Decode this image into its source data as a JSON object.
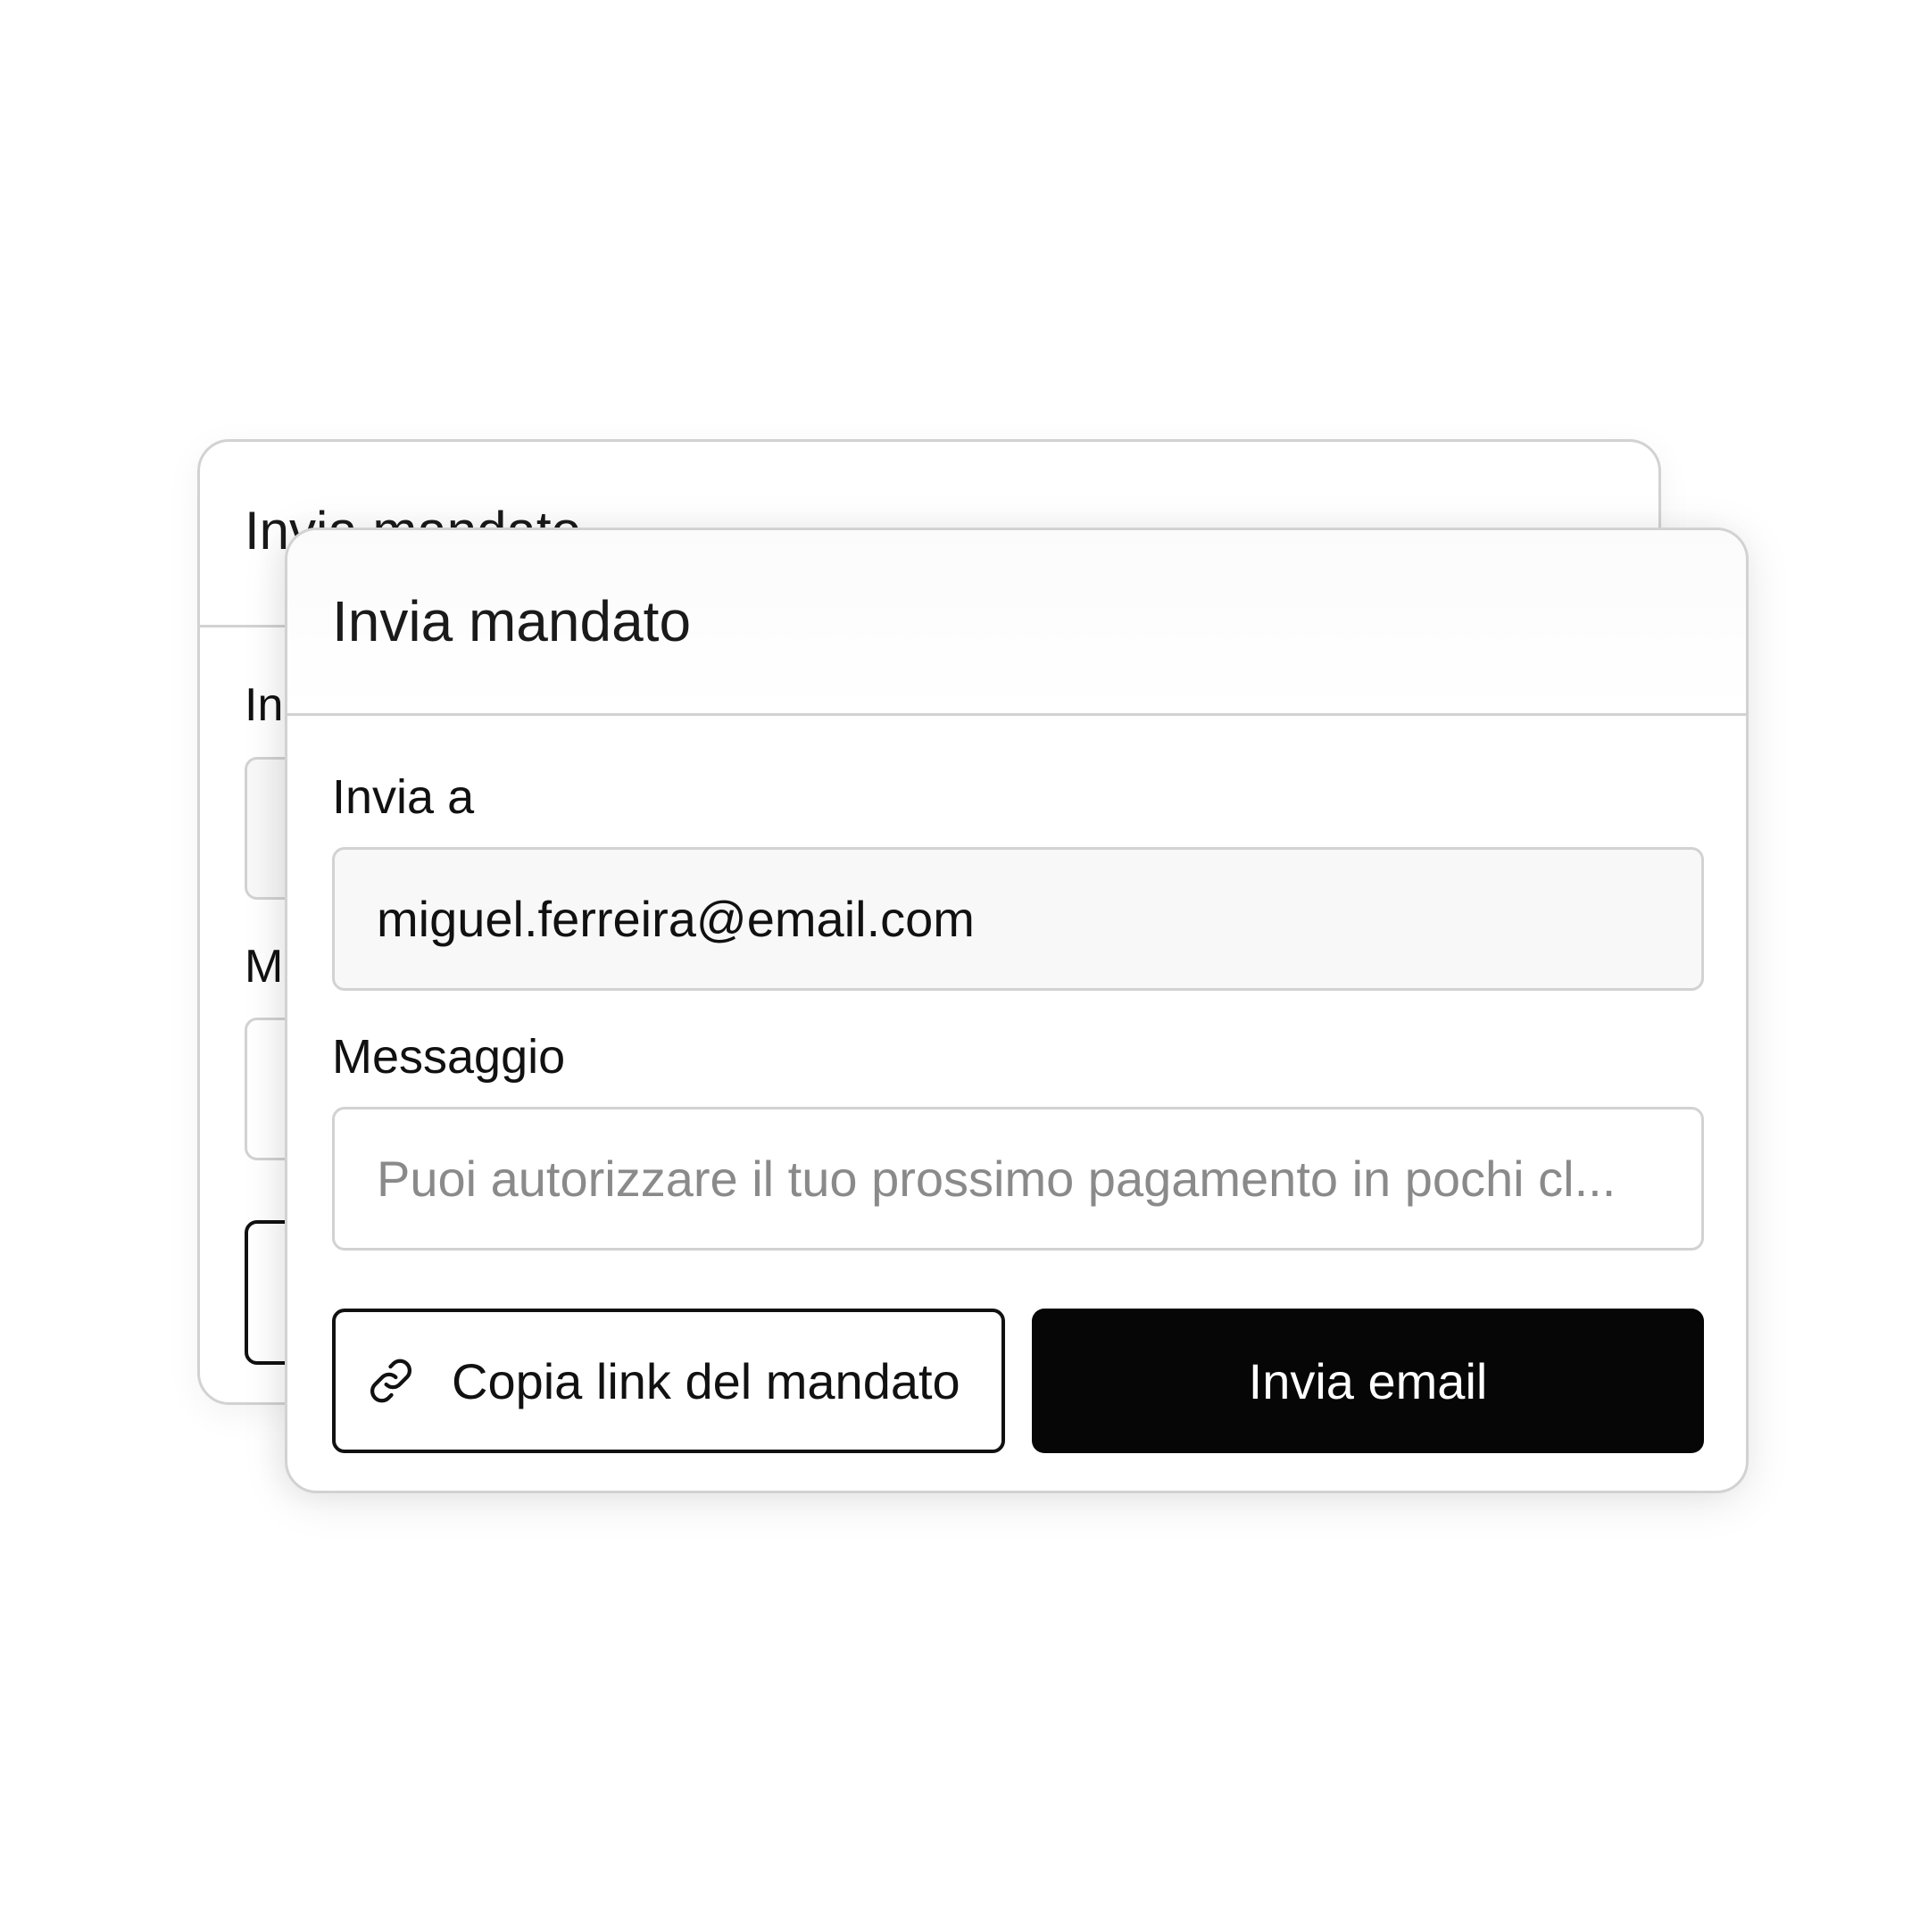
{
  "dialog_back": {
    "title": "Invia mandato",
    "label_to_partial": "In",
    "label_message_partial": "M"
  },
  "dialog": {
    "title": "Invia mandato",
    "to_label": "Invia a",
    "email_value": "miguel.ferreira@email.com",
    "message_label": "Messaggio",
    "message_value": "Puoi autorizzare il tuo prossimo pagamento in pochi cl...",
    "copy_button_label": "Copia link del mandato",
    "send_button_label": "Invia email",
    "copy_icon": "link-icon"
  },
  "colors": {
    "border": "#d2d2d2",
    "primary_button_bg": "#060606",
    "primary_button_text": "#ffffff",
    "input_filled_bg": "#f8f8f8",
    "placeholder_text": "#8a8a8a"
  }
}
